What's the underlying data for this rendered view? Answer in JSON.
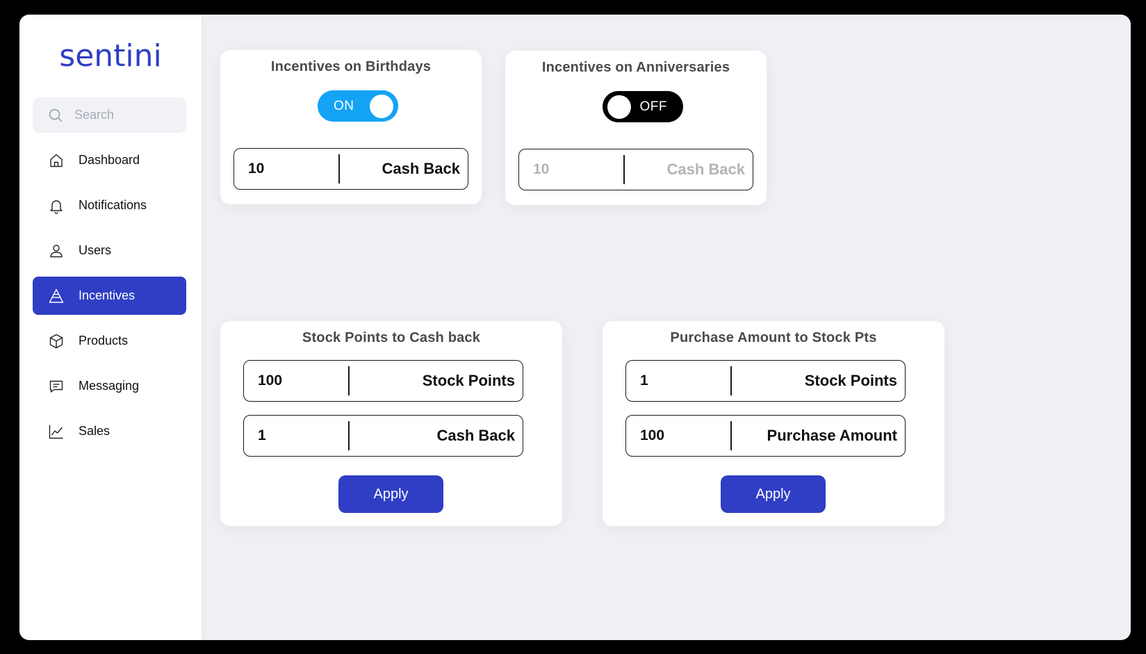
{
  "sidebar": {
    "logo": "sentini",
    "search_placeholder": "Search",
    "items": [
      {
        "label": "Dashboard",
        "icon": "home-icon"
      },
      {
        "label": "Notifications",
        "icon": "bell-icon"
      },
      {
        "label": "Users",
        "icon": "user-icon"
      },
      {
        "label": "Incentives",
        "icon": "pyramid-icon",
        "active": true
      },
      {
        "label": "Products",
        "icon": "box-icon"
      },
      {
        "label": "Messaging",
        "icon": "message-icon"
      },
      {
        "label": "Sales",
        "icon": "chart-line-icon"
      }
    ]
  },
  "cards": {
    "birthdays": {
      "title": "Incentives on Birthdays",
      "toggle": "ON",
      "value": "10",
      "unit": "Cash Back"
    },
    "anniversaries": {
      "title": "Incentives on Anniversaries",
      "toggle": "OFF",
      "value": "10",
      "unit": "Cash Back"
    },
    "stock_to_cash": {
      "title": "Stock Points to Cash back",
      "field1": {
        "value": "100",
        "unit": "Stock Points"
      },
      "field2": {
        "value": "1",
        "unit": "Cash Back"
      },
      "button": "Apply"
    },
    "purchase_to_stock": {
      "title": "Purchase Amount to Stock Pts",
      "field1": {
        "value": "1",
        "unit": "Stock Points"
      },
      "field2": {
        "value": "100",
        "unit": "Purchase Amount"
      },
      "button": "Apply"
    }
  },
  "colors": {
    "brand": "#2f3ec4",
    "toggle_on": "#14a3f5",
    "toggle_off": "#000000",
    "background": "#eff0f4"
  }
}
